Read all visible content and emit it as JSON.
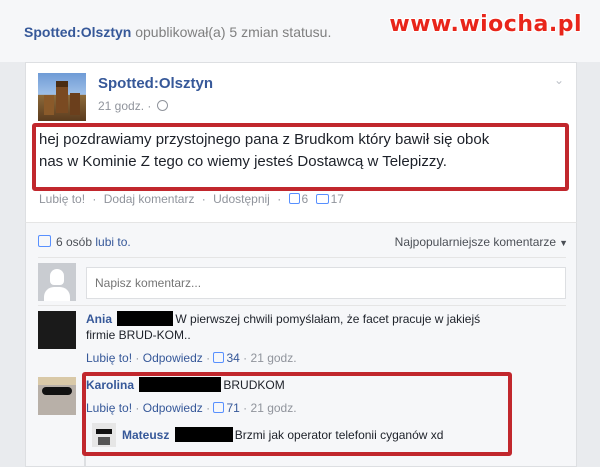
{
  "header": {
    "page_name": "Spotted:Olsztyn",
    "action_text": "opublikował(a) 5 zmian statusu.",
    "watermark": "www.wiocha.pl"
  },
  "post": {
    "page_name": "Spotted:Olsztyn",
    "time": "21 godz.",
    "text_line1": "hej pozdrawiamy przystojnego pana z Brudkom który bawił się obok",
    "text_line2": "nas w Kominie Z tego co wiemy jesteś Dostawcą w Telepizzy.",
    "actions": {
      "like": "Lubię to!",
      "comment": "Dodaj komentarz",
      "share": "Udostępnij",
      "likes_count": "6",
      "comments_count": "17"
    }
  },
  "comments_section": {
    "likes_summary_count": "6 osób",
    "likes_summary_suffix": "lubi to.",
    "sort_label": "Najpopularniejsze komentarze",
    "input_placeholder": "Napisz komentarz...",
    "comments": [
      {
        "author": "Ania",
        "text_line1": "W pierwszej chwili pomyślałam, że facet pracuje w jakiejś",
        "text_line2": "firmie BRUD-KOM..",
        "like_label": "Lubię to!",
        "reply_label": "Odpowiedz",
        "likes": "34",
        "time": "21 godz."
      },
      {
        "author": "Karolina",
        "text_line1": "BRUDKOM",
        "like_label": "Lubię to!",
        "reply_label": "Odpowiedz",
        "likes": "71",
        "time": "21 godz."
      }
    ],
    "reply": {
      "author": "Mateusz",
      "text": "Brzmi jak operator telefonii cyganów xd"
    }
  },
  "colors": {
    "highlight": "#c1272d",
    "link": "#365899",
    "watermark": "#e8251a"
  }
}
